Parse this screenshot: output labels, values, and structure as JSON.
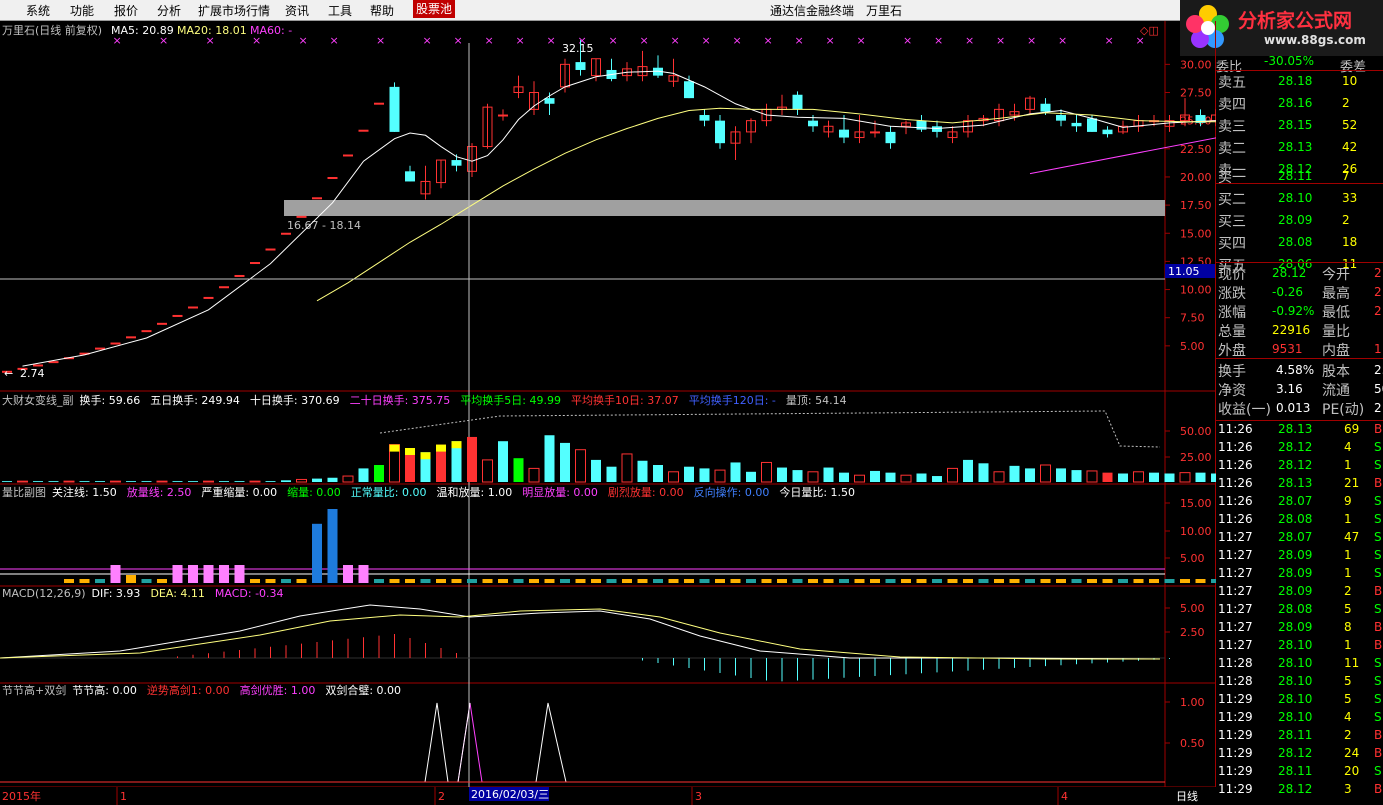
{
  "menu": {
    "items": [
      "系统",
      "功能",
      "报价",
      "分析",
      "扩展市场行情",
      "资讯",
      "工具",
      "帮助",
      "股票池"
    ],
    "app_title": "通达信金融终端",
    "stock_name": "万里石"
  },
  "logo": {
    "line1": "分析家公式网",
    "line2": "www.88gs.com"
  },
  "main_chart": {
    "title": "万里石(日线 前复权)",
    "ma5": "MA5: 20.89",
    "ma20": "MA20: 18.01",
    "ma60": "MA60: -",
    "peak_label": "32.15",
    "low_label": "2.74",
    "band_label": "16.67 - 18.14",
    "crosshair_price": "11.05",
    "yticks": [
      "30.00",
      "27.50",
      "25.00",
      "22.50",
      "20.00",
      "17.50",
      "15.00",
      "12.50",
      "10.00",
      "7.50",
      "5.00"
    ],
    "colors": {
      "up": "#ff3232",
      "down": "#54ffff",
      "ma5": "#ffffff",
      "ma20": "#ffff80",
      "ma60": "#ff40ff"
    }
  },
  "turnover_panel": {
    "name": "大财女变线_副",
    "items": [
      {
        "text": "换手: 59.66",
        "color": "#ffffff"
      },
      {
        "text": "五日换手: 249.94",
        "color": "#ffffff"
      },
      {
        "text": "十日换手: 370.69",
        "color": "#ffffff"
      },
      {
        "text": "二十日换手: 375.75",
        "color": "#ff40ff"
      },
      {
        "text": "平均换手5日: 49.99",
        "color": "#00ff00"
      },
      {
        "text": "平均换手10日: 37.07",
        "color": "#ff3232"
      },
      {
        "text": "平均换手120日: -",
        "color": "#4060ff"
      },
      {
        "text": "量顶: 54.14",
        "color": "#c0c0c0"
      }
    ],
    "yticks": [
      "50.00",
      "25.00"
    ]
  },
  "volume_ratio_panel": {
    "name": "量比副图",
    "items": [
      {
        "text": "关注线: 1.50",
        "color": "#ffffff"
      },
      {
        "text": "放量线: 2.50",
        "color": "#ff40ff"
      },
      {
        "text": "严重缩量: 0.00",
        "color": "#ffffff"
      },
      {
        "text": "缩量: 0.00",
        "color": "#00ff00"
      },
      {
        "text": "正常量比: 0.00",
        "color": "#54ffff"
      },
      {
        "text": "温和放量: 1.00",
        "color": "#ffffff"
      },
      {
        "text": "明显放量: 0.00",
        "color": "#ff40ff"
      },
      {
        "text": "剧烈放量: 0.00",
        "color": "#ff3232"
      },
      {
        "text": "反向操作: 0.00",
        "color": "#4080ff"
      },
      {
        "text": "今日量比: 1.50",
        "color": "#ffffff"
      }
    ],
    "yticks": [
      "15.00",
      "10.00",
      "5.00"
    ]
  },
  "macd_panel": {
    "name": "MACD(12,26,9)",
    "items": [
      {
        "text": "DIF: 3.93",
        "color": "#ffffff"
      },
      {
        "text": "DEA: 4.11",
        "color": "#ffff80"
      },
      {
        "text": "MACD: -0.34",
        "color": "#ff40ff"
      }
    ],
    "yticks": [
      "5.00",
      "2.50"
    ]
  },
  "sword_panel": {
    "name": "节节高+双剑",
    "items": [
      {
        "text": "节节高: 0.00",
        "color": "#ffffff"
      },
      {
        "text": "逆势高剑1: 0.00",
        "color": "#ff3232"
      },
      {
        "text": "高剑优胜: 1.00",
        "color": "#ff40ff"
      },
      {
        "text": "双剑合璧: 0.00",
        "color": "#ffffff"
      }
    ],
    "yticks": [
      "1.00",
      "0.50"
    ]
  },
  "time_axis": {
    "labels": [
      "2015年",
      "1",
      "2",
      "3",
      "4"
    ],
    "cursor": "2016/02/03/三",
    "period": "日线"
  },
  "quote": {
    "ratio_label": "委比",
    "ratio_value": "-30.05%",
    "ratio_extra": "委差",
    "asks": [
      {
        "label": "卖五",
        "price": "28.18",
        "vol": "10"
      },
      {
        "label": "卖四",
        "price": "28.16",
        "vol": "2"
      },
      {
        "label": "卖三",
        "price": "28.15",
        "vol": "52"
      },
      {
        "label": "卖二",
        "price": "28.13",
        "vol": "42"
      },
      {
        "label": "卖一",
        "price": "28.12",
        "vol": "26"
      }
    ],
    "bids": [
      {
        "label": "买一",
        "price": "28.11",
        "vol": "7"
      },
      {
        "label": "买二",
        "price": "28.10",
        "vol": "33"
      },
      {
        "label": "买三",
        "price": "28.09",
        "vol": "2"
      },
      {
        "label": "买四",
        "price": "28.08",
        "vol": "18"
      },
      {
        "label": "买五",
        "price": "28.06",
        "vol": "11"
      }
    ],
    "stats": [
      {
        "l1": "现价",
        "v1": "28.12",
        "c1": "#00ff00",
        "l2": "今开",
        "v2": "2"
      },
      {
        "l1": "涨跌",
        "v1": "-0.26",
        "c1": "#00ff00",
        "l2": "最高",
        "v2": "2"
      },
      {
        "l1": "涨幅",
        "v1": "-0.92%",
        "c1": "#00ff00",
        "l2": "最低",
        "v2": "2"
      },
      {
        "l1": "总量",
        "v1": "22916",
        "c1": "#ffff00",
        "l2": "量比",
        "v2": ""
      },
      {
        "l1": "外盘",
        "v1": "9531",
        "c1": "#ff3232",
        "l2": "内盘",
        "v2": "1"
      }
    ],
    "fund": [
      {
        "l1": "换手",
        "v1": "4.58%",
        "l2": "股本",
        "v2": "2."
      },
      {
        "l1": "净资",
        "v1": "3.16",
        "l2": "流通",
        "v2": "50"
      },
      {
        "l1": "收益(一)",
        "v1": "0.013",
        "l2": "PE(动)",
        "v2": "2"
      }
    ],
    "ticks": [
      {
        "time": "11:26",
        "price": "28.13",
        "vol": "69",
        "side": "B"
      },
      {
        "time": "11:26",
        "price": "28.12",
        "vol": "4",
        "side": "S"
      },
      {
        "time": "11:26",
        "price": "28.12",
        "vol": "1",
        "side": "S"
      },
      {
        "time": "11:26",
        "price": "28.13",
        "vol": "21",
        "side": "B"
      },
      {
        "time": "11:26",
        "price": "28.07",
        "vol": "9",
        "side": "S"
      },
      {
        "time": "11:26",
        "price": "28.08",
        "vol": "1",
        "side": "S"
      },
      {
        "time": "11:27",
        "price": "28.07",
        "vol": "47",
        "side": "S"
      },
      {
        "time": "11:27",
        "price": "28.09",
        "vol": "1",
        "side": "S"
      },
      {
        "time": "11:27",
        "price": "28.09",
        "vol": "1",
        "side": "S"
      },
      {
        "time": "11:27",
        "price": "28.09",
        "vol": "2",
        "side": "B"
      },
      {
        "time": "11:27",
        "price": "28.08",
        "vol": "5",
        "side": "S"
      },
      {
        "time": "11:27",
        "price": "28.09",
        "vol": "8",
        "side": "B"
      },
      {
        "time": "11:27",
        "price": "28.10",
        "vol": "1",
        "side": "B"
      },
      {
        "time": "11:28",
        "price": "28.10",
        "vol": "11",
        "side": "S"
      },
      {
        "time": "11:28",
        "price": "28.10",
        "vol": "5",
        "side": "S"
      },
      {
        "time": "11:29",
        "price": "28.10",
        "vol": "5",
        "side": "S"
      },
      {
        "time": "11:29",
        "price": "28.10",
        "vol": "4",
        "side": "S"
      },
      {
        "time": "11:29",
        "price": "28.11",
        "vol": "2",
        "side": "B"
      },
      {
        "time": "11:29",
        "price": "28.12",
        "vol": "24",
        "side": "B"
      },
      {
        "time": "11:29",
        "price": "28.11",
        "vol": "20",
        "side": "S"
      },
      {
        "time": "11:29",
        "price": "28.12",
        "vol": "3",
        "side": "B"
      }
    ]
  },
  "chart_data": {
    "type": "candlestick",
    "ylim": [
      2.5,
      31.5
    ],
    "candles": [
      [
        2.74,
        2.74,
        2.74,
        2.74
      ],
      [
        3.0,
        3.0,
        3.0,
        3.0
      ],
      [
        3.3,
        3.3,
        3.3,
        3.3
      ],
      [
        3.6,
        3.6,
        3.6,
        3.6
      ],
      [
        3.95,
        3.95,
        3.95,
        3.95
      ],
      [
        4.35,
        4.35,
        4.35,
        4.35
      ],
      [
        4.8,
        4.8,
        4.8,
        4.8
      ],
      [
        5.25,
        5.25,
        5.25,
        5.25
      ],
      [
        5.8,
        5.8,
        5.8,
        5.8
      ],
      [
        6.35,
        6.35,
        6.35,
        6.35
      ],
      [
        7.0,
        7.0,
        7.0,
        7.0
      ],
      [
        7.7,
        7.7,
        7.7,
        7.7
      ],
      [
        8.45,
        8.45,
        8.45,
        8.45
      ],
      [
        9.3,
        9.3,
        9.3,
        9.3
      ],
      [
        10.25,
        10.25,
        10.25,
        10.25
      ],
      [
        11.25,
        11.25,
        11.25,
        11.25
      ],
      [
        12.4,
        12.4,
        12.4,
        12.4
      ],
      [
        13.6,
        13.6,
        13.6,
        13.6
      ],
      [
        15.0,
        15.0,
        15.0,
        15.0
      ],
      [
        16.5,
        16.5,
        16.5,
        16.5
      ],
      [
        18.15,
        18.15,
        18.15,
        18.15
      ],
      [
        19.95,
        19.95,
        19.95,
        19.95
      ],
      [
        21.95,
        21.95,
        21.95,
        21.95
      ],
      [
        24.15,
        24.15,
        24.15,
        24.15
      ],
      [
        26.55,
        26.55,
        26.55,
        26.55
      ],
      [
        28.0,
        28.4,
        24.0,
        24.0
      ],
      [
        20.5,
        21.0,
        19.6,
        19.6
      ],
      [
        18.5,
        21.0,
        18.0,
        19.6
      ],
      [
        19.5,
        21.5,
        19.0,
        21.5
      ],
      [
        21.5,
        22.0,
        20.5,
        21.0
      ],
      [
        20.5,
        23.0,
        20.0,
        22.7
      ],
      [
        22.7,
        26.5,
        22.5,
        26.2
      ],
      [
        25.5,
        26.0,
        25.0,
        25.5
      ],
      [
        27.5,
        29.0,
        27.0,
        28.0
      ],
      [
        26.0,
        28.5,
        25.5,
        27.5
      ],
      [
        27.0,
        27.5,
        25.5,
        26.5
      ],
      [
        28.0,
        30.5,
        27.5,
        30.0
      ],
      [
        30.2,
        32.15,
        29.0,
        29.5
      ],
      [
        29.0,
        30.5,
        28.5,
        30.5
      ],
      [
        29.5,
        30.5,
        28.5,
        28.7
      ],
      [
        29.0,
        30.2,
        28.5,
        29.6
      ],
      [
        29.0,
        31.2,
        28.5,
        29.8
      ],
      [
        29.7,
        30.8,
        28.8,
        29.0
      ],
      [
        28.5,
        30.5,
        28.0,
        29.0
      ],
      [
        28.5,
        29.0,
        27.0,
        27.0
      ],
      [
        25.5,
        26.0,
        24.5,
        25.0
      ],
      [
        25.0,
        25.5,
        22.5,
        23.0
      ],
      [
        23.0,
        24.5,
        21.5,
        24.0
      ],
      [
        24.0,
        25.2,
        23.0,
        25.0
      ],
      [
        25.0,
        26.5,
        24.5,
        26.0
      ],
      [
        26.0,
        27.3,
        25.5,
        26.2
      ],
      [
        27.3,
        27.6,
        25.5,
        26.0
      ],
      [
        25.0,
        25.5,
        24.0,
        24.5
      ],
      [
        24.0,
        25.0,
        23.5,
        24.5
      ],
      [
        24.2,
        25.5,
        23.0,
        23.5
      ],
      [
        23.5,
        25.5,
        23.0,
        24.0
      ],
      [
        24.0,
        25.0,
        23.5,
        24.0
      ],
      [
        24.0,
        24.5,
        22.5,
        23.0
      ],
      [
        24.5,
        25.0,
        23.8,
        24.8
      ],
      [
        25.0,
        25.5,
        24.0,
        24.2
      ],
      [
        24.5,
        25.0,
        23.5,
        24.0
      ],
      [
        23.5,
        24.5,
        23.0,
        24.0
      ],
      [
        24.0,
        25.5,
        23.5,
        25.0
      ],
      [
        25.0,
        25.5,
        24.5,
        25.2
      ],
      [
        25.0,
        26.5,
        24.5,
        26.0
      ],
      [
        25.5,
        26.5,
        25.0,
        25.8
      ],
      [
        26.0,
        27.2,
        25.5,
        27.0
      ],
      [
        26.5,
        27.0,
        25.5,
        25.8
      ],
      [
        25.5,
        26.0,
        24.5,
        25.0
      ],
      [
        24.8,
        25.5,
        24.0,
        24.5
      ],
      [
        25.2,
        25.5,
        24.0,
        24.0
      ],
      [
        24.2,
        24.5,
        23.5,
        23.8
      ],
      [
        24.0,
        25.0,
        23.8,
        24.5
      ],
      [
        24.5,
        25.5,
        24.0,
        25.0
      ],
      [
        25.0,
        25.5,
        24.5,
        25.0
      ],
      [
        24.5,
        25.5,
        24.0,
        25.0
      ],
      [
        25.0,
        27.0,
        24.5,
        25.5
      ],
      [
        25.5,
        26.0,
        24.5,
        24.8
      ],
      [
        25.0,
        26.0,
        24.5,
        25.5
      ],
      [
        25.0,
        27.0,
        24.8,
        26.0
      ]
    ],
    "ma5": [
      [
        1,
        3.2
      ],
      [
        5,
        4.2
      ],
      [
        9,
        5.7
      ],
      [
        13,
        8.2
      ],
      [
        17,
        12.3
      ],
      [
        21,
        17.7
      ],
      [
        23,
        21.4
      ],
      [
        25,
        23.4
      ],
      [
        26,
        23.9
      ],
      [
        27,
        23.7
      ],
      [
        28,
        22.7
      ],
      [
        29,
        21.8
      ],
      [
        30,
        21.4
      ],
      [
        31,
        21.9
      ],
      [
        32,
        23.3
      ],
      [
        33,
        25.1
      ],
      [
        34,
        26.3
      ],
      [
        35,
        27.2
      ],
      [
        36,
        28.0
      ],
      [
        38,
        28.9
      ],
      [
        40,
        29.3
      ],
      [
        42,
        29.4
      ],
      [
        43,
        29.2
      ],
      [
        45,
        28.0
      ],
      [
        47,
        26.5
      ],
      [
        49,
        25.5
      ],
      [
        51,
        25.3
      ],
      [
        54,
        25.2
      ],
      [
        57,
        24.5
      ],
      [
        60,
        24.3
      ],
      [
        63,
        24.6
      ],
      [
        66,
        25.6
      ],
      [
        68,
        25.9
      ],
      [
        70,
        25.2
      ],
      [
        72,
        24.4
      ],
      [
        75,
        24.8
      ],
      [
        78,
        25.0
      ],
      [
        80,
        25.3
      ]
    ],
    "ma20": [
      [
        20,
        9.0
      ],
      [
        22,
        10.6
      ],
      [
        24,
        12.4
      ],
      [
        26,
        14.2
      ],
      [
        28,
        15.8
      ],
      [
        30,
        17.5
      ],
      [
        32,
        19.2
      ],
      [
        34,
        20.7
      ],
      [
        36,
        22.1
      ],
      [
        38,
        23.3
      ],
      [
        40,
        24.3
      ],
      [
        42,
        25.2
      ],
      [
        44,
        25.9
      ],
      [
        46,
        26.1
      ],
      [
        48,
        26.0
      ],
      [
        50,
        26.0
      ],
      [
        52,
        26.0
      ],
      [
        55,
        25.6
      ],
      [
        58,
        25.1
      ],
      [
        61,
        24.8
      ],
      [
        64,
        25.2
      ],
      [
        67,
        25.7
      ],
      [
        70,
        25.5
      ],
      [
        73,
        25.0
      ],
      [
        76,
        24.9
      ],
      [
        80,
        24.9
      ]
    ],
    "ma60": [
      [
        66,
        20.3
      ],
      [
        80,
        24.0
      ]
    ]
  }
}
